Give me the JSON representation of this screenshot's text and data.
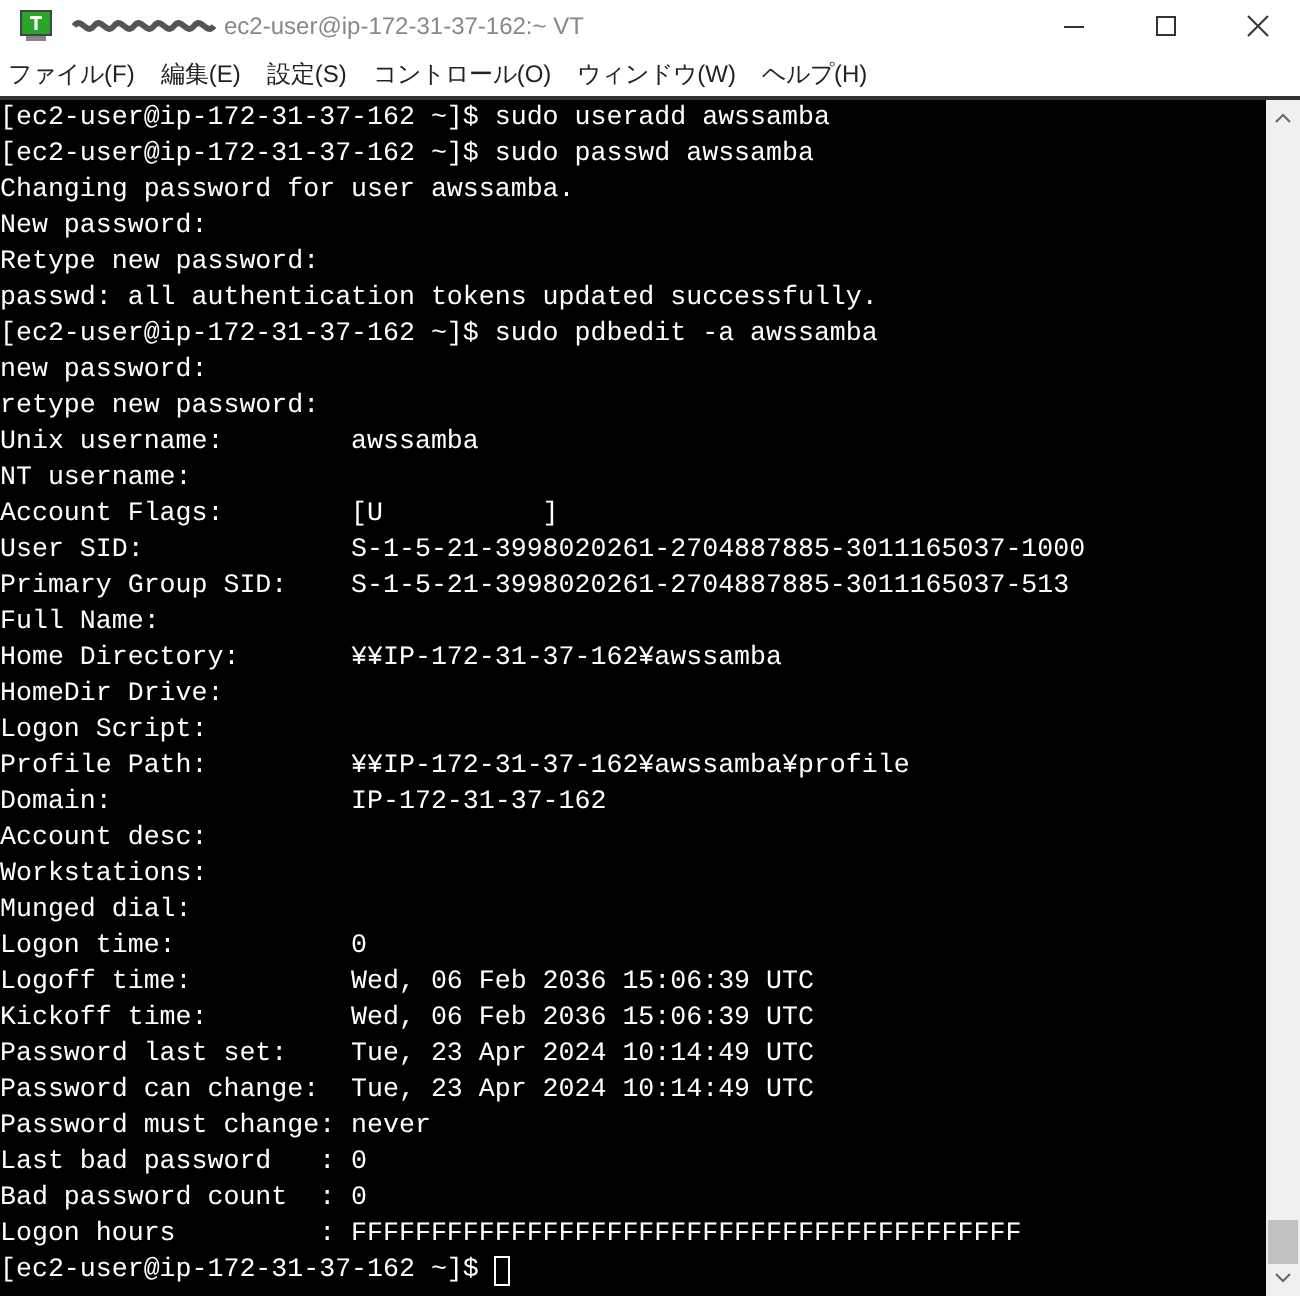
{
  "window": {
    "title": "ec2-user@ip-172-31-37-162:~ VT"
  },
  "menu": [
    "ファイル(F)",
    "編集(E)",
    "設定(S)",
    "コントロール(O)",
    "ウィンドウ(W)",
    "ヘルプ(H)"
  ],
  "terminal": {
    "lines": [
      "[ec2-user@ip-172-31-37-162 ~]$ sudo useradd awssamba",
      "[ec2-user@ip-172-31-37-162 ~]$ sudo passwd awssamba",
      "Changing password for user awssamba.",
      "New password:",
      "Retype new password:",
      "passwd: all authentication tokens updated successfully.",
      "[ec2-user@ip-172-31-37-162 ~]$ sudo pdbedit -a awssamba",
      "new password:",
      "retype new password:",
      "Unix username:        awssamba",
      "NT username:",
      "Account Flags:        [U          ]",
      "User SID:             S-1-5-21-3998020261-2704887885-3011165037-1000",
      "Primary Group SID:    S-1-5-21-3998020261-2704887885-3011165037-513",
      "Full Name:",
      "Home Directory:       ¥¥IP-172-31-37-162¥awssamba",
      "HomeDir Drive:",
      "Logon Script:",
      "Profile Path:         ¥¥IP-172-31-37-162¥awssamba¥profile",
      "Domain:               IP-172-31-37-162",
      "Account desc:",
      "Workstations:",
      "Munged dial:",
      "Logon time:           0",
      "Logoff time:          Wed, 06 Feb 2036 15:06:39 UTC",
      "Kickoff time:         Wed, 06 Feb 2036 15:06:39 UTC",
      "Password last set:    Tue, 23 Apr 2024 10:14:49 UTC",
      "Password can change:  Tue, 23 Apr 2024 10:14:49 UTC",
      "Password must change: never",
      "Last bad password   : 0",
      "Bad password count  : 0",
      "Logon hours         : FFFFFFFFFFFFFFFFFFFFFFFFFFFFFFFFFFFFFFFFFF"
    ],
    "prompt": "[ec2-user@ip-172-31-37-162 ~]$"
  }
}
